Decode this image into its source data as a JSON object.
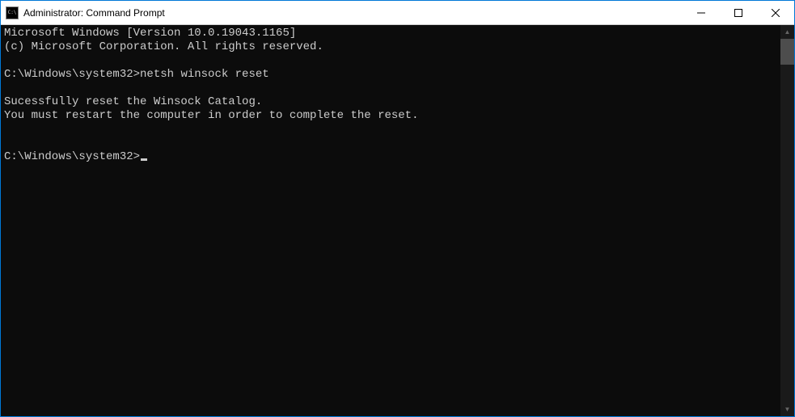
{
  "titlebar": {
    "title": "Administrator: Command Prompt"
  },
  "console": {
    "line1": "Microsoft Windows [Version 10.0.19043.1165]",
    "line2": "(c) Microsoft Corporation. All rights reserved.",
    "blank1": "",
    "prompt1": "C:\\Windows\\system32>",
    "command1": "netsh winsock reset",
    "blank2": "",
    "result1": "Sucessfully reset the Winsock Catalog.",
    "result2": "You must restart the computer in order to complete the reset.",
    "blank3": "",
    "blank4": "",
    "prompt2": "C:\\Windows\\system32>"
  }
}
